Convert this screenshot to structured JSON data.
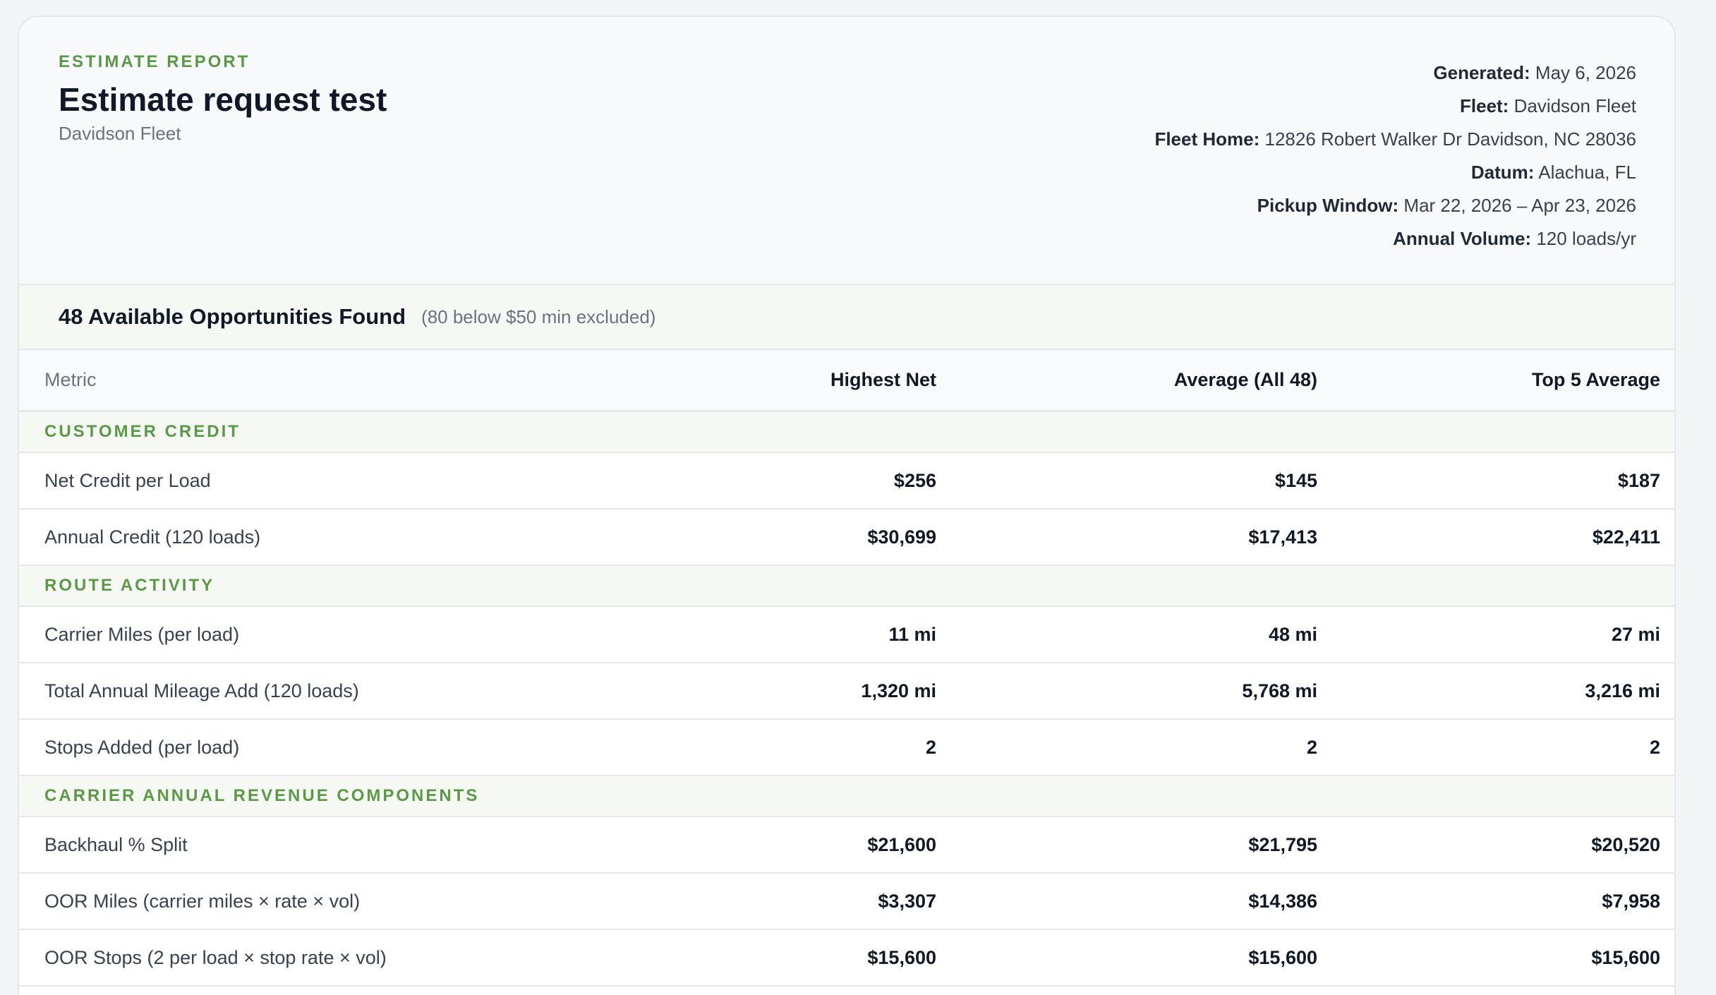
{
  "header": {
    "kicker": "ESTIMATE REPORT",
    "title": "Estimate request test",
    "subtitle": "Davidson Fleet",
    "meta": [
      {
        "label": "Generated:",
        "value": "May 6, 2026"
      },
      {
        "label": "Fleet:",
        "value": "Davidson Fleet"
      },
      {
        "label": "Fleet Home:",
        "value": "12826 Robert Walker Dr Davidson, NC 28036"
      },
      {
        "label": "Datum:",
        "value": "Alachua, FL"
      },
      {
        "label": "Pickup Window:",
        "value": "Mar 22, 2026 – Apr 23, 2026"
      },
      {
        "label": "Annual Volume:",
        "value": "120 loads/yr"
      }
    ]
  },
  "summary": {
    "title": "48 Available Opportunities Found",
    "note": "(80 below $50 min excluded)"
  },
  "table": {
    "columns": [
      "Metric",
      "Highest Net",
      "Average (All 48)",
      "Top 5 Average"
    ],
    "sections": [
      {
        "title": "CUSTOMER CREDIT",
        "rows": [
          [
            "Net Credit per Load",
            "$256",
            "$145",
            "$187"
          ],
          [
            "Annual Credit (120 loads)",
            "$30,699",
            "$17,413",
            "$22,411"
          ]
        ]
      },
      {
        "title": "ROUTE ACTIVITY",
        "rows": [
          [
            "Carrier Miles (per load)",
            "11 mi",
            "48 mi",
            "27 mi"
          ],
          [
            "Total Annual Mileage Add (120 loads)",
            "1,320 mi",
            "5,768 mi",
            "3,216 mi"
          ],
          [
            "Stops Added (per load)",
            "2",
            "2",
            "2"
          ]
        ]
      },
      {
        "title": "CARRIER ANNUAL REVENUE COMPONENTS",
        "rows": [
          [
            "Backhaul % Split",
            "$21,600",
            "$21,795",
            "$20,520"
          ],
          [
            "OOR Miles (carrier miles × rate × vol)",
            "$3,307",
            "$14,386",
            "$7,958"
          ],
          [
            "OOR Stops (2 per load × stop rate × vol)",
            "$15,600",
            "$15,600",
            "$15,600"
          ]
        ]
      }
    ]
  },
  "colors": {
    "accent": "#5a9a46",
    "background": "#f3f4f6",
    "card": "#ffffff",
    "border": "#e5e7eb"
  }
}
